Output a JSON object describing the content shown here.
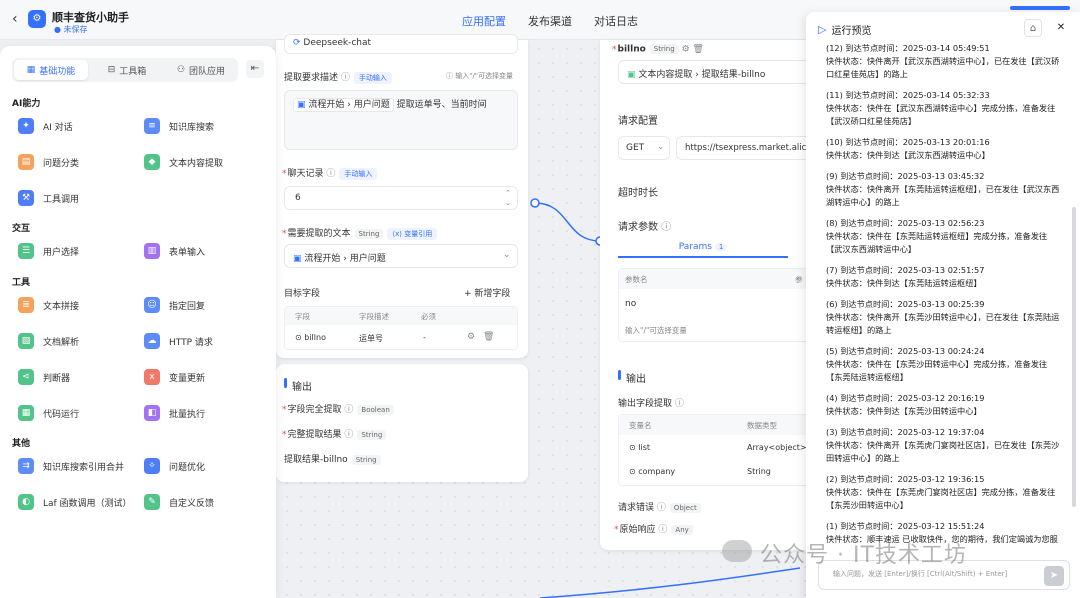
{
  "app": {
    "title": "顺丰查货小助手",
    "status": "未保存"
  },
  "top_tabs": [
    {
      "label": "应用配置",
      "active": true
    },
    {
      "label": "发布渠道",
      "active": false
    },
    {
      "label": "对话日志",
      "active": false
    }
  ],
  "left_panel": {
    "tabs": [
      {
        "label": "基础功能",
        "icon": "grid-icon",
        "active": true
      },
      {
        "label": "工具箱",
        "icon": "toolbox-icon",
        "active": false
      },
      {
        "label": "团队应用",
        "icon": "user-icon",
        "active": false
      }
    ],
    "sections": [
      {
        "title": "AI能力",
        "items": [
          {
            "label": "AI 对话",
            "icon": "ai-chat-icon",
            "color": "#4e7ef6"
          },
          {
            "label": "知识库搜索",
            "icon": "knowledge-search-icon",
            "color": "#5e8cf7"
          },
          {
            "label": "问题分类",
            "icon": "classify-icon",
            "color": "#f5a25d"
          },
          {
            "label": "文本内容提取",
            "icon": "extract-icon",
            "color": "#52c48a"
          },
          {
            "label": "工具调用",
            "icon": "tool-call-icon",
            "color": "#4e7ef6"
          }
        ]
      },
      {
        "title": "交互",
        "items": [
          {
            "label": "用户选择",
            "icon": "user-select-icon",
            "color": "#52c48a"
          },
          {
            "label": "表单输入",
            "icon": "form-input-icon",
            "color": "#a272f0"
          }
        ]
      },
      {
        "title": "工具",
        "items": [
          {
            "label": "文本拼接",
            "icon": "text-concat-icon",
            "color": "#f5a25d"
          },
          {
            "label": "指定回复",
            "icon": "reply-icon",
            "color": "#5e8cf7"
          },
          {
            "label": "文档解析",
            "icon": "doc-parse-icon",
            "color": "#52c48a"
          },
          {
            "label": "HTTP 请求",
            "icon": "http-icon",
            "color": "#5e8cf7"
          },
          {
            "label": "判断器",
            "icon": "branch-icon",
            "color": "#52c48a"
          },
          {
            "label": "变量更新",
            "icon": "variable-icon",
            "color": "#f07a6a"
          },
          {
            "label": "代码运行",
            "icon": "code-icon",
            "color": "#52c48a"
          },
          {
            "label": "批量执行",
            "icon": "batch-icon",
            "color": "#a272f0"
          }
        ]
      },
      {
        "title": "其他",
        "items": [
          {
            "label": "知识库搜索引用合并",
            "icon": "merge-icon",
            "color": "#5e8cf7"
          },
          {
            "label": "问题优化",
            "icon": "optimize-icon",
            "color": "#4e7ef6"
          },
          {
            "label": "Laf 函数调用（测试）",
            "icon": "laf-icon",
            "color": "#52c48a"
          },
          {
            "label": "自定义反馈",
            "icon": "feedback-icon",
            "color": "#52c48a"
          }
        ]
      }
    ]
  },
  "extract_node": {
    "model": "Deepseek-chat",
    "description_label": "提取要求描述",
    "description_mode": "手动输入",
    "description_hint": "输入\"/\"可选择变量",
    "description_ref": "流程开始 › 用户问题",
    "description_text": "提取运单号、当前时间",
    "history_label": "聊天记录",
    "history_mode": "手动输入",
    "history_value": "6",
    "text_label": "需要提取的文本",
    "text_type": "String",
    "text_mode": "变量引用",
    "text_ref": "流程开始 › 用户问题",
    "target_label": "目标字段",
    "add_field": "+ 新增字段",
    "target_headers": [
      "字段",
      "字段描述",
      "必须"
    ],
    "target_rows": [
      {
        "field": "billno",
        "desc": "运单号",
        "required": "-"
      }
    ],
    "output_title": "输出",
    "outputs": [
      {
        "label": "字段完全提取",
        "type": "Boolean",
        "required": true
      },
      {
        "label": "完整提取结果",
        "type": "String",
        "required": true
      },
      {
        "label": "提取结果-billno",
        "type": "String",
        "required": false
      }
    ]
  },
  "http_node": {
    "param_name": "billno",
    "param_type": "String",
    "param_ref": "文本内容提取 › 提取结果-billno",
    "request_config_label": "请求配置",
    "method": "GET",
    "url": "https://tsexpress.market.alicl",
    "timeout_label": "超时时长",
    "params_label": "请求参数",
    "params_tab": "Params",
    "params_count": "1",
    "params_headers": [
      "参数名",
      "参"
    ],
    "params_rows": [
      {
        "name": "no"
      }
    ],
    "params_input_placeholder": "输入\"/\"可选择变量",
    "output_title": "输出",
    "output_extract_label": "输出字段提取",
    "output_headers": [
      "变量名",
      "数据类型"
    ],
    "output_rows": [
      {
        "name": "list",
        "type": "Array<object>"
      },
      {
        "name": "company",
        "type": "String"
      }
    ],
    "error_label": "请求错误",
    "error_type": "Object",
    "raw_label": "原始响应",
    "raw_type": "Any"
  },
  "preview": {
    "title": "运行预览",
    "logs": [
      {
        "time": "(12) 到达节点时间：2025-03-14 05:49:51",
        "text": "快件状态：快件离开【武汉东西湖转运中心】，已在发往【武汉硚口红星佳苑店】的路上"
      },
      {
        "time": "(11) 到达节点时间：2025-03-14 05:32:33",
        "text": "快件状态：快件在【武汉东西湖转运中心】完成分拣，准备发往【武汉硚口红星佳苑店】"
      },
      {
        "time": "(10) 到达节点时间：2025-03-13 20:01:16",
        "text": "快件状态：快件到达【武汉东西湖转运中心】"
      },
      {
        "time": "(9) 到达节点时间：2025-03-13 03:45:32",
        "text": "快件状态：快件离开【东莞陆运转运枢纽】，已在发往【武汉东西湖转运中心】的路上"
      },
      {
        "time": "(8) 到达节点时间：2025-03-13 02:56:23",
        "text": "快件状态：快件在【东莞陆运转运枢纽】完成分拣，准备发往【武汉东西湖转运中心】"
      },
      {
        "time": "(7) 到达节点时间：2025-03-13 02:51:57",
        "text": "快件状态：快件到达【东莞陆运转运枢纽】"
      },
      {
        "time": "(6) 到达节点时间：2025-03-13 00:25:39",
        "text": "快件状态：快件离开【东莞沙田转运中心】，已在发往【东莞陆运转运枢纽】的路上"
      },
      {
        "time": "(5) 到达节点时间：2025-03-13 00:24:24",
        "text": "快件状态：快件在【东莞沙田转运中心】完成分拣，准备发往【东莞陆运转运枢纽】"
      },
      {
        "time": "(4) 到达节点时间：2025-03-12 20:16:19",
        "text": "快件状态：快件到达【东莞沙田转运中心】"
      },
      {
        "time": "(3) 到达节点时间：2025-03-12 19:37:04",
        "text": "快件状态：快件离开【东莞虎门宴岗社区店】，已在发往【东莞沙田转运中心】的路上"
      },
      {
        "time": "(2) 到达节点时间：2025-03-12 19:36:15",
        "text": "快件状态：快件在【东莞虎门宴岗社区店】完成分拣，准备发往【东莞沙田转运中心】"
      },
      {
        "time": "(1) 到达节点时间：2025-03-12 15:51:24",
        "text": "快件状态：顺丰速运 已收取快件，您的期待，我们定竭诚为您服务"
      }
    ],
    "input_placeholder": "输入问题，发送 [Enter]/换行 [Ctrl(Alt/Shift) + Enter]"
  },
  "watermark": "公众号 · IT技术工坊"
}
